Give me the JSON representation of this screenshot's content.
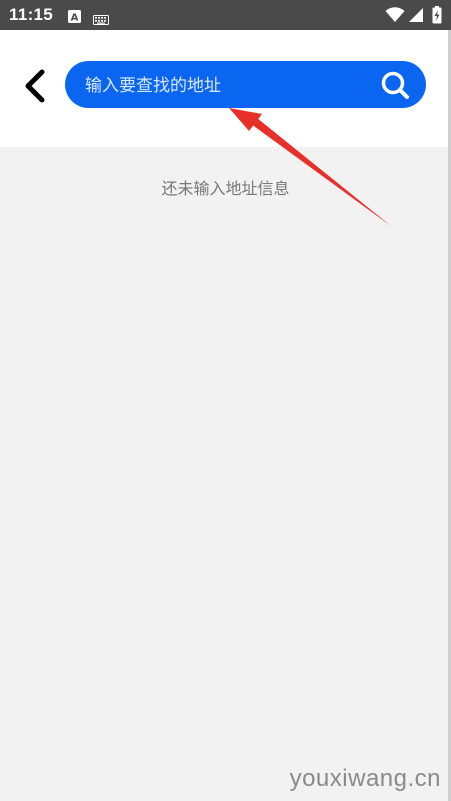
{
  "status_bar": {
    "time": "11:15",
    "icons": [
      "a-notification-icon",
      "keyboard-icon",
      "wifi-icon",
      "signal-icon",
      "battery-charging-icon"
    ]
  },
  "header": {
    "back_icon": "chevron-left-icon",
    "search": {
      "placeholder": "输入要查找的地址",
      "value": "",
      "background_color": "#0a66f0",
      "icon": "search-icon"
    }
  },
  "content": {
    "empty_message": "还未输入地址信息"
  },
  "watermark": "youxiwang.cn",
  "annotation": {
    "arrow_color": "#e8302a"
  }
}
